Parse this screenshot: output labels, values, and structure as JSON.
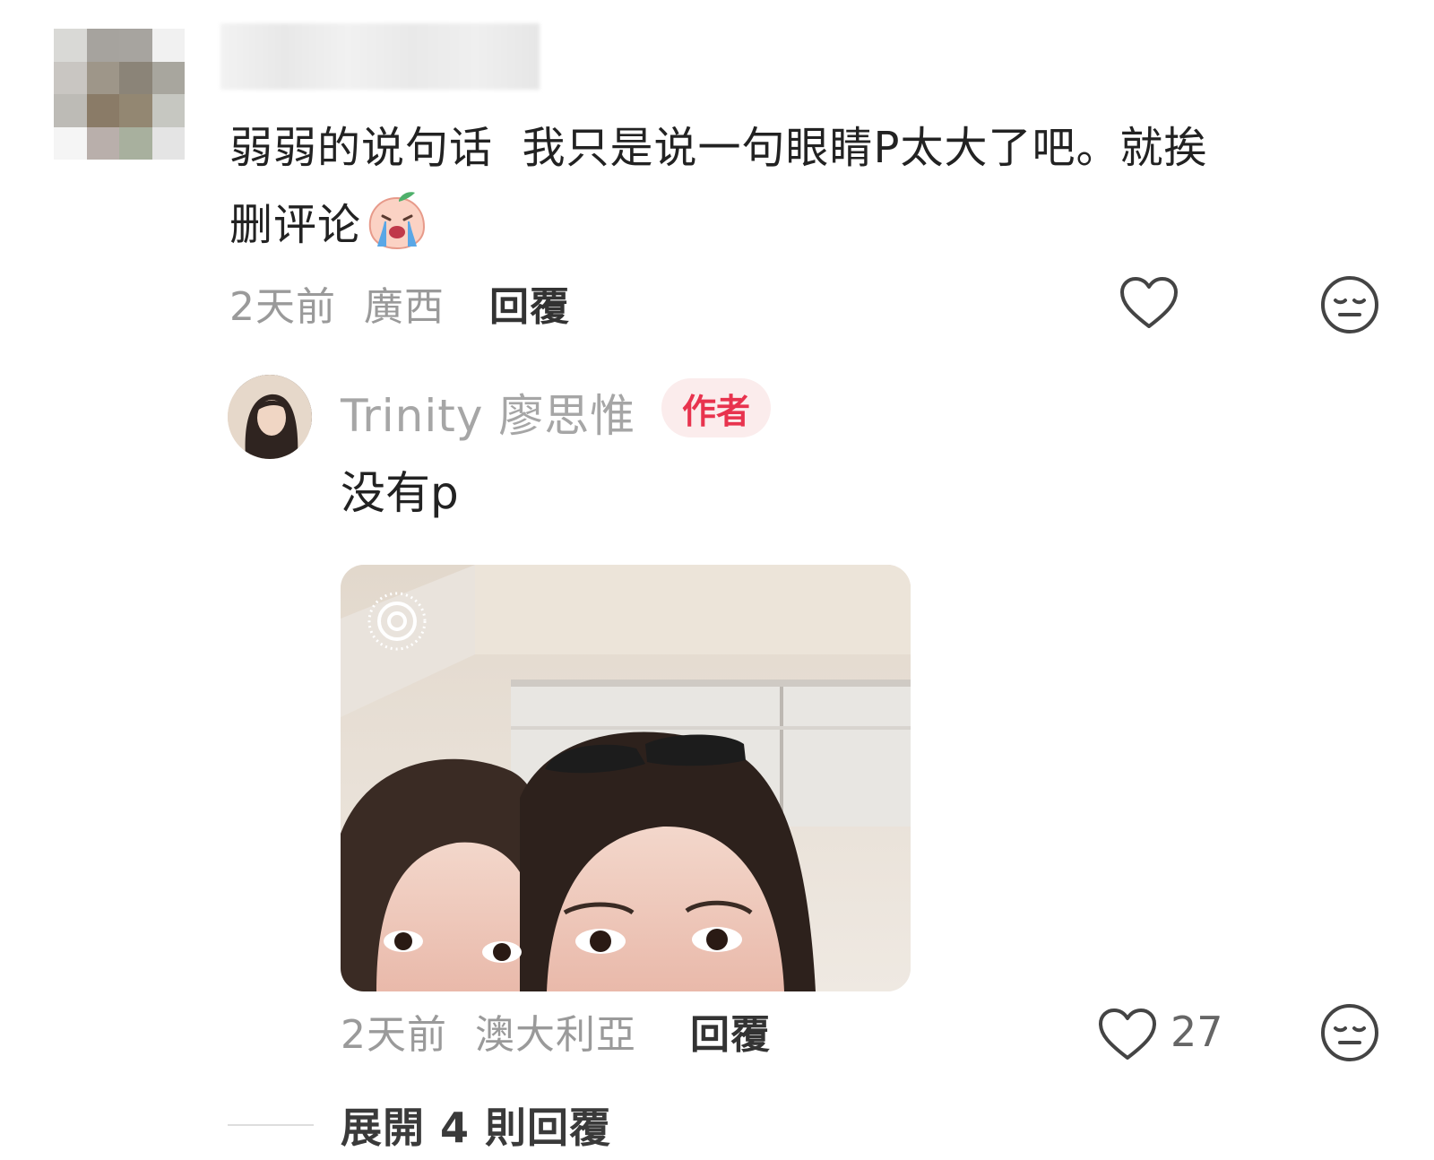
{
  "first_comment": {
    "username": "",
    "text_line1": "弱弱的说句话  我只是说一句眼睛P太大了吧。就挨",
    "text_line2": "删评论",
    "time": "2天前",
    "location": "廣西",
    "reply_label": "回覆",
    "emoji_icon": "crying-peach-emoji"
  },
  "reply": {
    "author_name": "Trinity 廖思惟",
    "author_badge": "作者",
    "text": "没有p",
    "photo_alt": "selfie photo",
    "live_photo_icon": "live-photo-icon",
    "time": "2天前",
    "location": "澳大利亞",
    "reply_label": "回覆",
    "like_count": "27"
  },
  "expand": {
    "label": "展開 4 則回覆"
  },
  "colors": {
    "author_badge_bg": "#fbecec",
    "author_badge_text": "#e8334e",
    "meta_gray": "#9a9a9a"
  }
}
